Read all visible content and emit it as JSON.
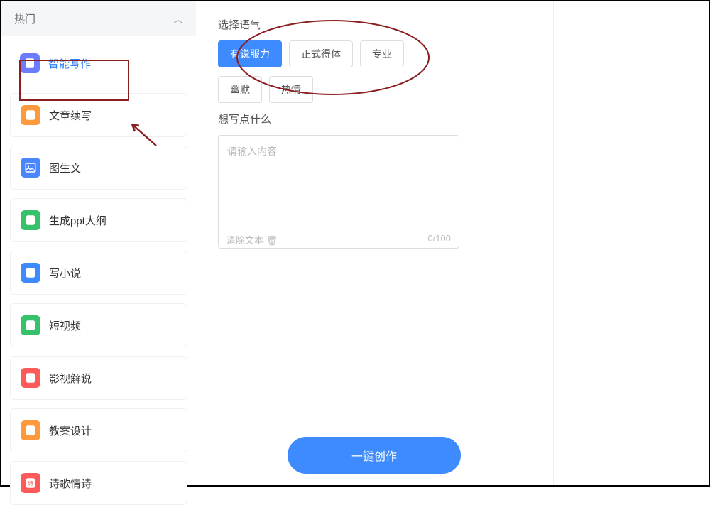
{
  "sidebar": {
    "header": "热门",
    "items": [
      {
        "label": "智能写作",
        "iconBg": "#6b7cff",
        "icon": "doc"
      },
      {
        "label": "文章续写",
        "iconBg": "#ff9a3c",
        "icon": "doc"
      },
      {
        "label": "图生文",
        "iconBg": "#4a86ff",
        "icon": "image"
      },
      {
        "label": "生成ppt大纲",
        "iconBg": "#35c26b",
        "icon": "doc"
      },
      {
        "label": "写小说",
        "iconBg": "#3d8bff",
        "icon": "doc"
      },
      {
        "label": "短视频",
        "iconBg": "#35c26b",
        "icon": "doc"
      },
      {
        "label": "影视解说",
        "iconBg": "#ff5a5a",
        "icon": "doc"
      },
      {
        "label": "教案设计",
        "iconBg": "#ff9a3c",
        "icon": "doc"
      },
      {
        "label": "诗歌情诗",
        "iconBg": "#ff5a5a",
        "icon": "poem"
      }
    ]
  },
  "main": {
    "toneLabel": "选择语气",
    "tones": [
      "有说服力",
      "正式得体",
      "专业",
      "幽默",
      "热情"
    ],
    "selectedTone": "有说服力",
    "contentLabel": "想写点什么",
    "placeholder": "请输入内容",
    "clearText": "清除文本",
    "counter": "0/100",
    "submit": "一键创作"
  }
}
